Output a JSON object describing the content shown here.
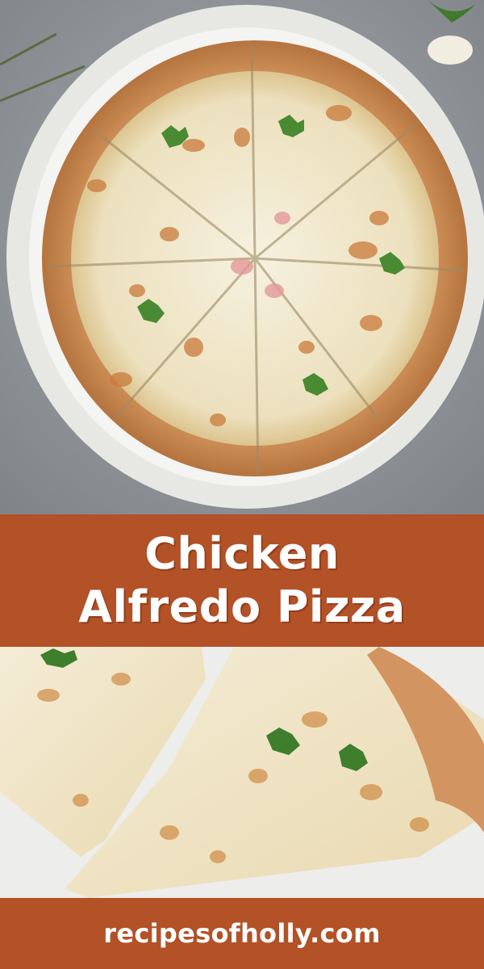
{
  "title": {
    "line1": "Chicken",
    "line2": "Alfredo Pizza"
  },
  "footer": {
    "url": "recipesofholly.com"
  },
  "colors": {
    "banner": "#b35127",
    "text": "#ffffff",
    "countertop": "#8e9296",
    "plate": "#f1f1ef",
    "crust": "#c98a54",
    "cheese": "#f2ead2"
  },
  "images": {
    "top": "whole-pizza-on-plate-photo",
    "bottom": "pizza-slices-closeup-photo"
  }
}
